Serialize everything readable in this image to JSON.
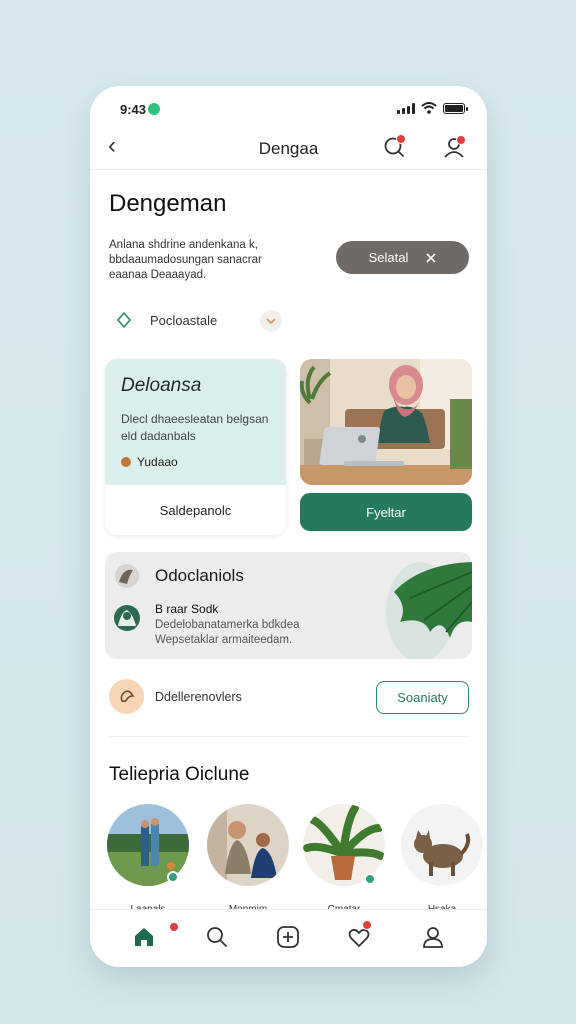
{
  "status_bar": {
    "time": "9:43"
  },
  "nav": {
    "back_glyph": "‹",
    "title": "Dengaa"
  },
  "header": {
    "title": "Dengeman",
    "description": "Anlana shdrine andenkana k, bbdaaumadosungan sanacrar eaanaa Deaaayad.",
    "action_button": {
      "label": "Selatal",
      "icon": "close-icon"
    }
  },
  "filter": {
    "label": "Pocloastale",
    "icon": "leaf-icon",
    "expand_icon": "chevron-down-icon"
  },
  "feature_card": {
    "title": "Deloansa",
    "text": "Dlecl dhaeesleatan belgsan eld dadanbals",
    "meta": "Yudaao",
    "button": "Saldepanolc"
  },
  "photo_card": {
    "alt": "woman in pink hijab working on laptop",
    "button": "Fyeltar"
  },
  "wide_card": {
    "title": "Odoclaniols",
    "subtitle": "B raar Sodk",
    "text": "Dedelobanatamerka bdkdea Wepsetaklar armaiteedam."
  },
  "list_row": {
    "label": "Ddellerenovlers",
    "button": "Soaniaty",
    "icon": "hand-icon"
  },
  "people": {
    "section_title": "Teliepria Oiclune",
    "items": [
      {
        "name": "Laapals",
        "online": true
      },
      {
        "name": "Monmim",
        "online": false
      },
      {
        "name": "Cmatar",
        "online": true
      },
      {
        "name": "Hsaka",
        "online": false
      }
    ]
  },
  "tabbar": {
    "items": [
      {
        "name": "home",
        "icon": "home-icon",
        "badge": true,
        "active": true
      },
      {
        "name": "search",
        "icon": "search-icon",
        "badge": false
      },
      {
        "name": "add",
        "icon": "add-icon",
        "badge": false
      },
      {
        "name": "favorites",
        "icon": "heart-icon",
        "badge": true
      },
      {
        "name": "profile",
        "icon": "user-icon",
        "badge": false
      }
    ]
  },
  "colors": {
    "accent": "#247a5e",
    "badge": "#e33c3c",
    "background": "#d7e9ee",
    "card_tint": "#daefec"
  }
}
